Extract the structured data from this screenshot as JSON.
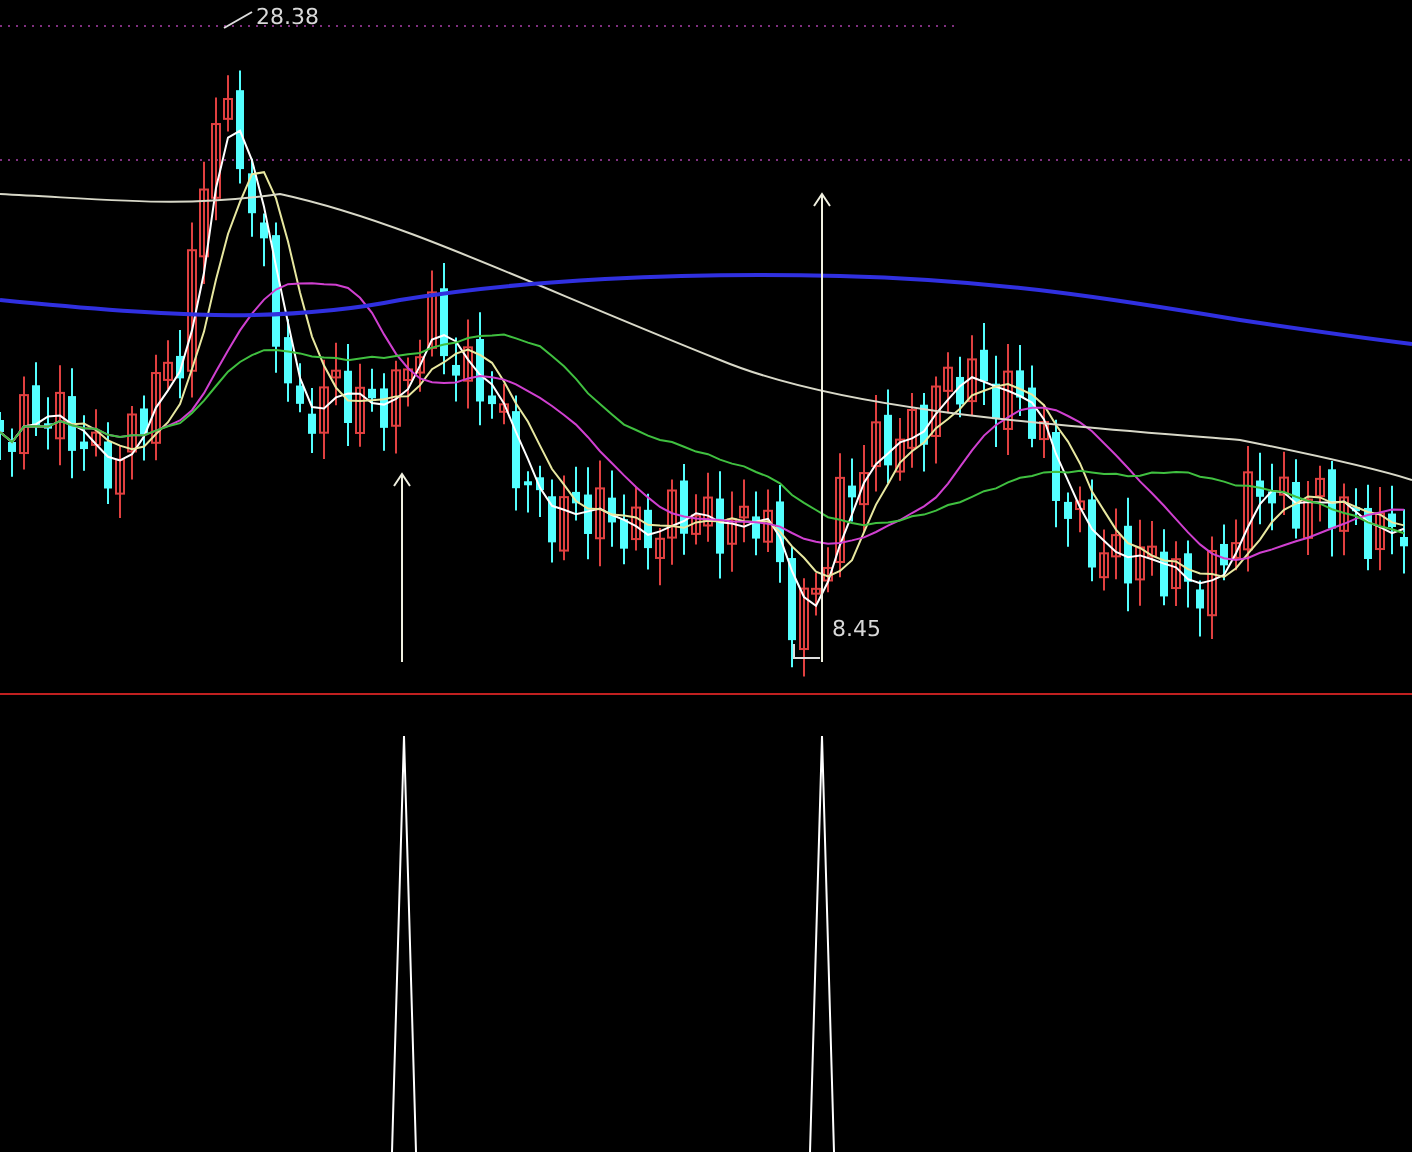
{
  "chart": {
    "high_label": "28.38",
    "low_label": "8.45"
  }
}
